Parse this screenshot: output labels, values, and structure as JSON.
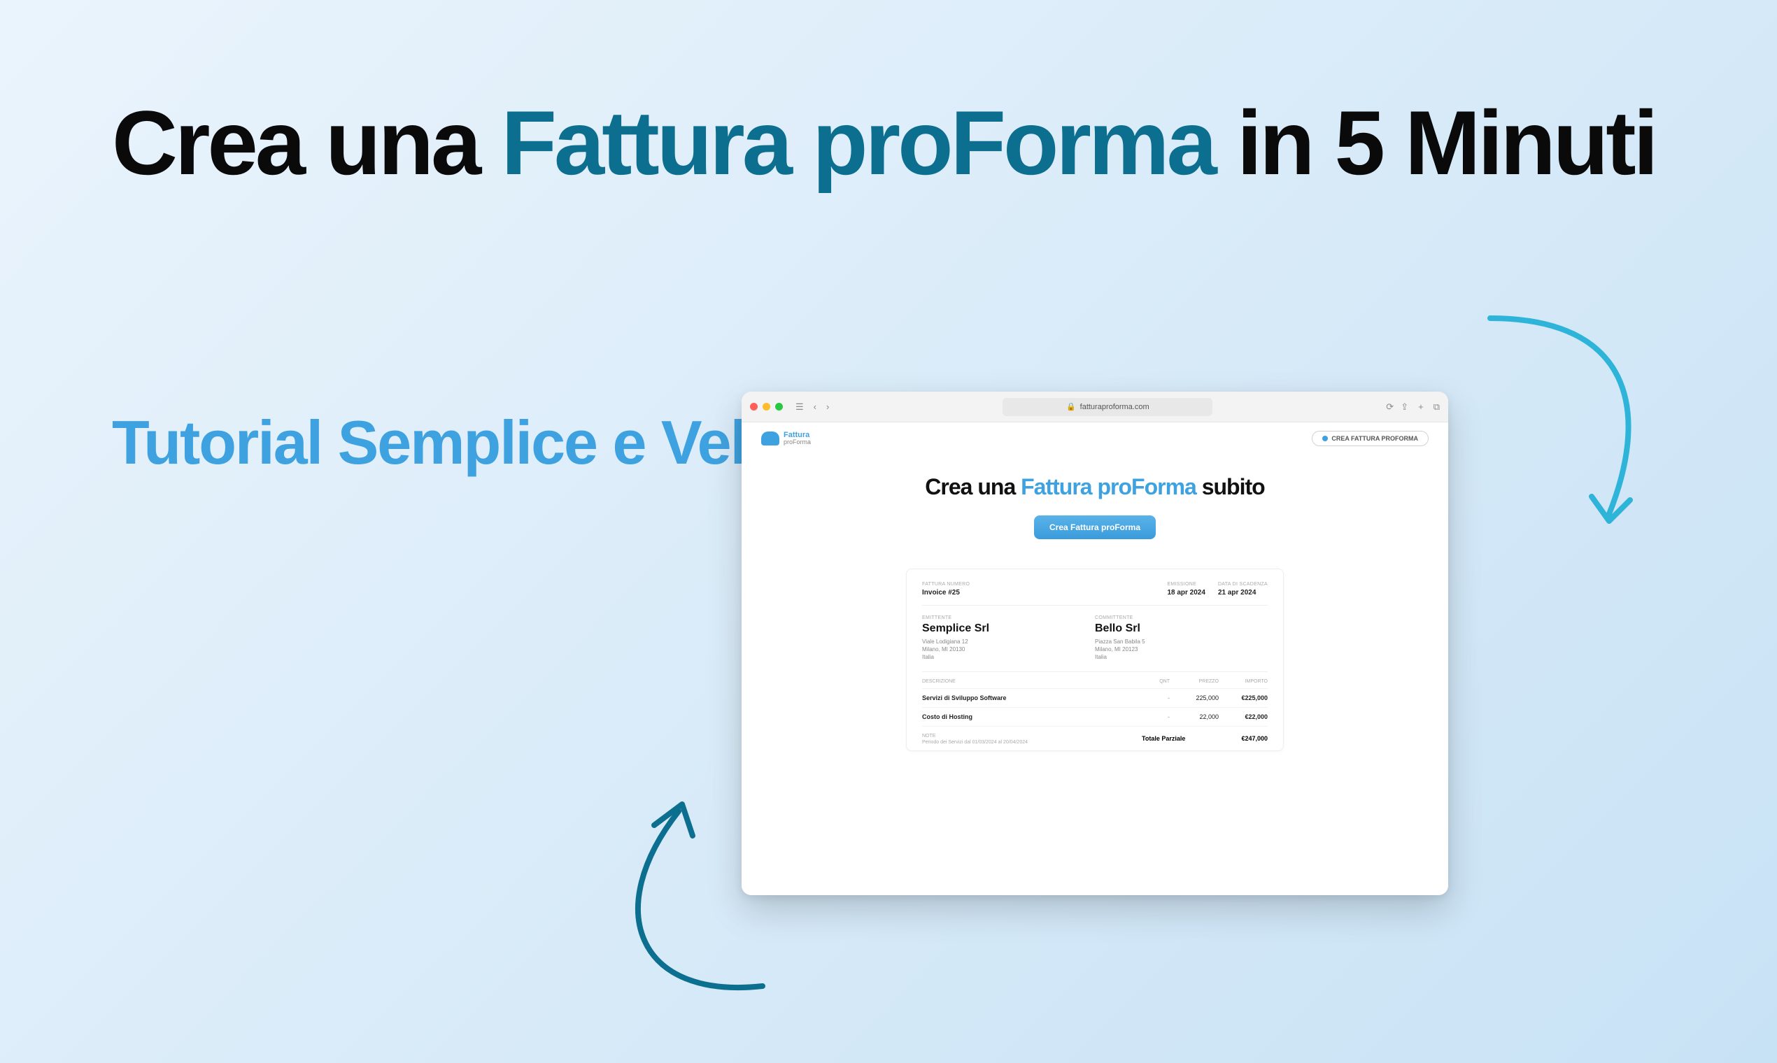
{
  "headline": {
    "part1": "Crea  una ",
    "accent": "Fattura proForma",
    "part2": " in 5 Minuti"
  },
  "subhead": "Tutorial Semplice e Veloce",
  "browser": {
    "url": "fatturaproforma.com",
    "logo": {
      "line1": "Fattura",
      "line2": "proForma"
    },
    "header_button": "CREA FATTURA PROFORMA",
    "hero": {
      "part1": "Crea una ",
      "accent": "Fattura proForma",
      "part2": " subito",
      "cta": "Crea Fattura proForma"
    },
    "invoice": {
      "labels": {
        "number": "FATTURA NUMERO",
        "emission": "EMISSIONE",
        "due": "DATA DI SCADENZA",
        "emitter": "EMITTENTE",
        "committer": "COMMITTENTE",
        "description": "DESCRIZIONE",
        "qty": "QNT",
        "price": "PREZZO",
        "amount": "IMPORTO",
        "note": "Note",
        "subtotal": "Totale Parziale"
      },
      "number": "Invoice #25",
      "emission_date": "18 apr 2024",
      "due_date": "21 apr 2024",
      "emitter": {
        "name": "Semplice Srl",
        "addr1": "Viale Lodigiana 12",
        "addr2": "Milano, MI 20130",
        "addr3": "Italia"
      },
      "committer": {
        "name": "Bello Srl",
        "addr1": "Piazza San Babila 5",
        "addr2": "Milano, MI 20123",
        "addr3": "Italia"
      },
      "lines": [
        {
          "desc": "Servizi di Sviluppo Software",
          "qty": "-",
          "price": "225,000",
          "amount": "€225,000"
        },
        {
          "desc": "Costo di Hosting",
          "qty": "-",
          "price": "22,000",
          "amount": "€22,000"
        }
      ],
      "note_text": "Periodo dei Servizi dal 01/03/2024 al 20/04/2024",
      "subtotal": "€247,000"
    }
  }
}
